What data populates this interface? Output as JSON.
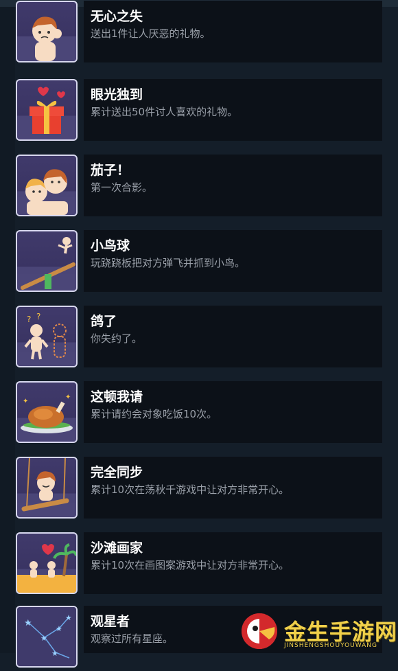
{
  "achievements": [
    {
      "title": "无心之失",
      "description": "送出1件让人厌恶的礼物。",
      "icon": "sad-boy-icon"
    },
    {
      "title": "眼光独到",
      "description": "累计送出50件讨人喜欢的礼物。",
      "icon": "gift-box-icon"
    },
    {
      "title": "茄子！",
      "description": "第一次合影。",
      "icon": "selfie-couple-icon"
    },
    {
      "title": "小鸟球",
      "description": "玩跷跷板把对方弹飞并抓到小鸟。",
      "icon": "seesaw-icon"
    },
    {
      "title": "鸽了",
      "description": "你失约了。",
      "icon": "missing-person-icon"
    },
    {
      "title": "这顿我请",
      "description": "累计请约会对象吃饭10次。",
      "icon": "roast-chicken-icon"
    },
    {
      "title": "完全同步",
      "description": "累计10次在荡秋千游戏中让对方非常开心。",
      "icon": "swing-icon"
    },
    {
      "title": "沙滩画家",
      "description": "累计10次在画图案游戏中让对方非常开心。",
      "icon": "beach-drawing-icon"
    },
    {
      "title": "观星者",
      "description": "观察过所有星座。",
      "icon": "constellation-icon"
    }
  ],
  "watermark": {
    "text": "金生手游网",
    "subtext": "JINSHENGSHOUYOUWANG",
    "icon": "parrot-logo-icon"
  }
}
